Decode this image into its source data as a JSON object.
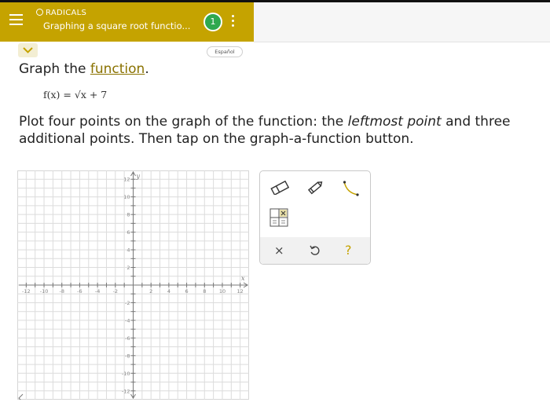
{
  "header": {
    "section_label": "RADICALS",
    "title": "Graphing a square root functio...",
    "progress_badge": "1"
  },
  "language_button": "Español",
  "problem": {
    "heading_prefix": "Graph the",
    "heading_link": "function",
    "heading_suffix": ".",
    "formula": "f(x) = √x + 7",
    "instructions_part1": "Plot four points on the graph of the function: the",
    "instructions_emphasis": "leftmost point",
    "instructions_part2": "and three additional points. Then tap on the graph-a-function button."
  },
  "graph": {
    "x_axis_label": "x",
    "y_axis_label": "y",
    "x_range": [
      -13,
      13
    ],
    "y_range": [
      -13,
      13
    ],
    "x_tick_labels": [
      "-12",
      "-10",
      "-8",
      "-6",
      "-4",
      "-2",
      "2",
      "4",
      "6",
      "8",
      "10",
      "12"
    ],
    "y_tick_labels": [
      "12",
      "10",
      "8",
      "6",
      "4",
      "2",
      "-2",
      "-4",
      "-6",
      "-8",
      "-10",
      "-12"
    ]
  },
  "tools": {
    "eraser_icon": "eraser-icon",
    "pencil_icon": "pencil-icon",
    "graph_function_icon": "curve-icon",
    "table_icon": "table-icon",
    "clear_label": "×",
    "undo_icon": "undo-icon",
    "help_label": "?",
    "accent_color": "#c5a300",
    "help_color": "#c5a300"
  }
}
